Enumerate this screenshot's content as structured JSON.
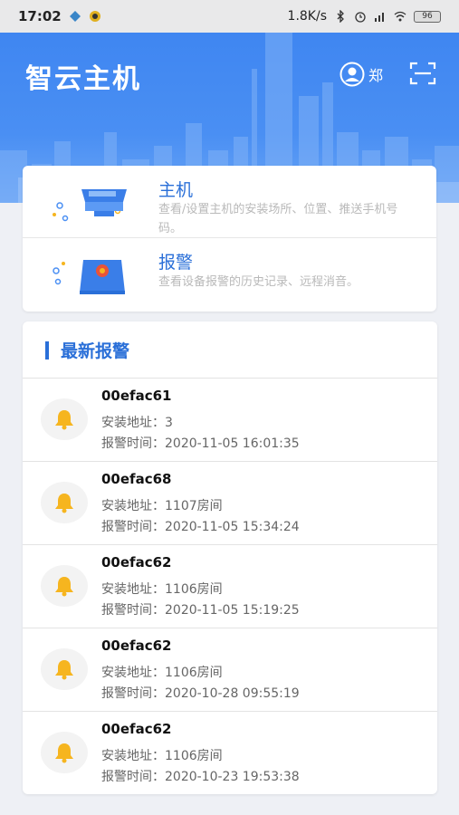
{
  "status_bar": {
    "time": "17:02",
    "net_speed": "1.8K/s",
    "battery": "96"
  },
  "header": {
    "title": "智云主机",
    "user_name": "郑"
  },
  "modules": [
    {
      "title": "主机",
      "desc": "查看/设置主机的安装场所、位置、推送手机号码。"
    },
    {
      "title": "报警",
      "desc": "查看设备报警的历史记录、远程消音。"
    }
  ],
  "alarms": {
    "section_title": "最新报警",
    "items": [
      {
        "id": "00efac61",
        "address": "安装地址：3",
        "time": "报警时间：2020-11-05 16:01:35"
      },
      {
        "id": "00efac68",
        "address": "安装地址：1107房间",
        "time": "报警时间：2020-11-05 15:34:24"
      },
      {
        "id": "00efac62",
        "address": "安装地址：1106房间",
        "time": "报警时间：2020-11-05 15:19:25"
      },
      {
        "id": "00efac62",
        "address": "安装地址：1106房间",
        "time": "报警时间：2020-10-28 09:55:19"
      },
      {
        "id": "00efac62",
        "address": "安装地址：1106房间",
        "time": "报警时间：2020-10-23 19:53:38"
      }
    ]
  },
  "colors": {
    "header_blue": "#3f86f1",
    "accent_blue": "#2a6fd8",
    "bell_yellow": "#f6b51f"
  },
  "icons": {
    "user": "user-circle-icon",
    "scan": "scan-icon",
    "alarm": "bell-icon"
  }
}
